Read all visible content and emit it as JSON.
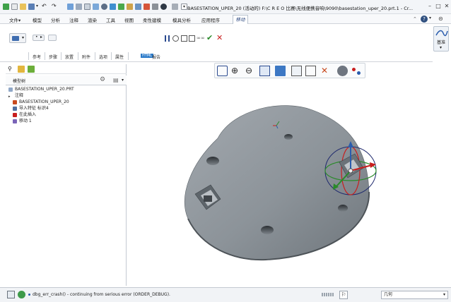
{
  "window": {
    "title": "BASESTATION_UPER_20 (活动的) F:\\C R E O 比赛\\无线便携音响\\9090\\basestation_uper_20.prt.1 - Cr...",
    "help_icon": "help-icon",
    "buttons": [
      "minimize",
      "restore",
      "close"
    ]
  },
  "menu": {
    "items": [
      "文件▾",
      "模型",
      "分析",
      "注释",
      "渲染",
      "工具",
      "视图",
      "柔性建模",
      "模具分析",
      "应用程序"
    ],
    "active_tab": "移动"
  },
  "ribbon": {
    "subtabs": [
      "参考",
      "步骤",
      "放置",
      "附件",
      "选项",
      "属性"
    ],
    "report_badge": "HTML",
    "report_label": "报告",
    "datum_label": "基准",
    "datum_arrow": "▾"
  },
  "tree": {
    "header": "模型树",
    "items": [
      "BASESTATION_UPER_20.PRT",
      "注释",
      "BASESTATION_UPER_20",
      "导入特征 标识4",
      "在此插入",
      "移动 1"
    ]
  },
  "status": {
    "message": "dbg_err_crash() - continuing from serious error (ORDER_DEBUG).",
    "filter_value": "几何"
  },
  "colors": {
    "model_gray": "#8e959c",
    "accent_blue": "#2a5cad",
    "cancel_red": "#c81e1e",
    "ok_green": "#2a8a2a"
  }
}
